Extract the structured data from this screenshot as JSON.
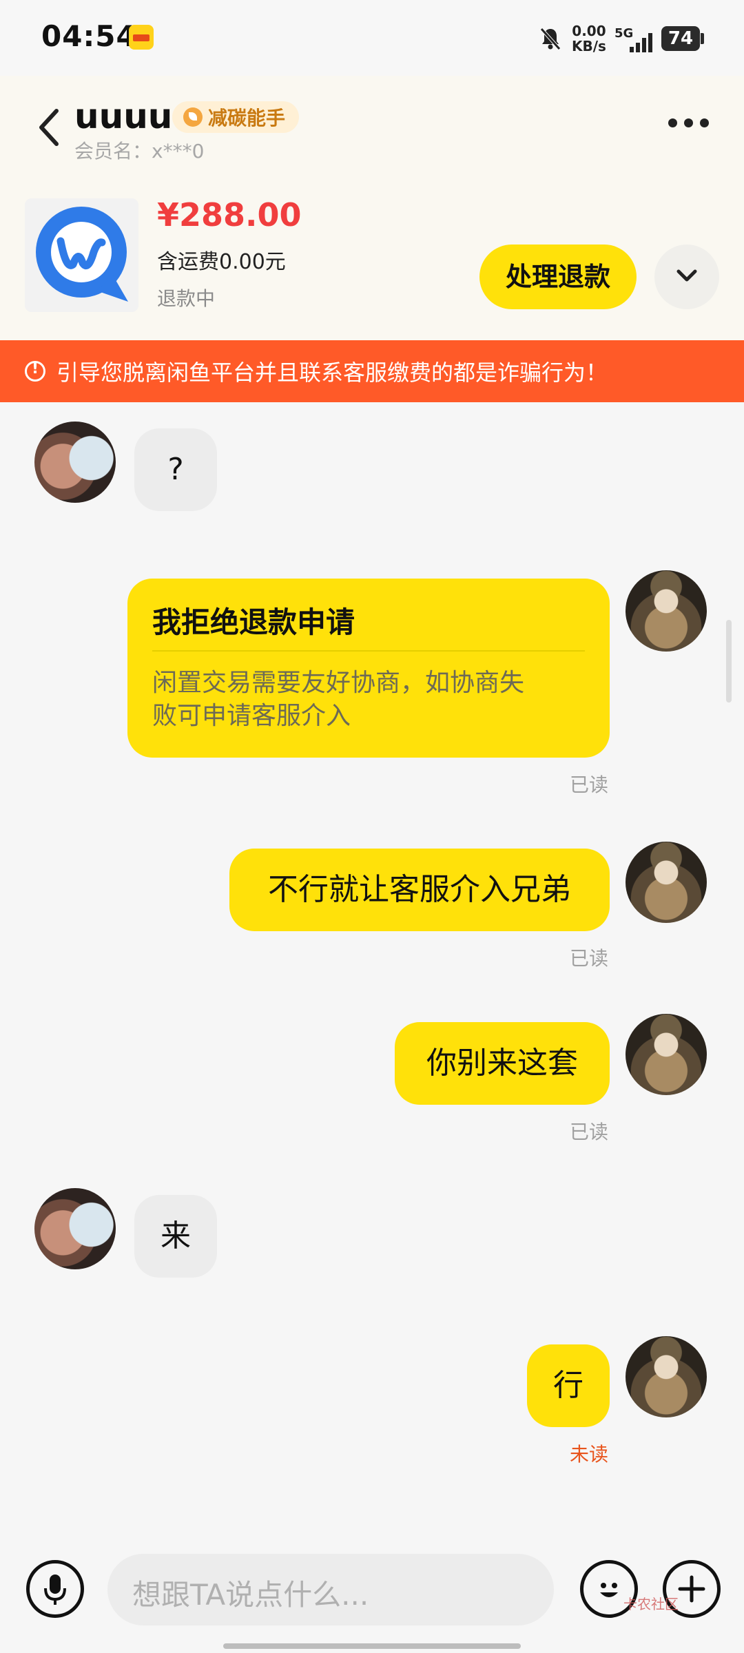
{
  "status_bar": {
    "time": "04:54",
    "net_speed_value": "0.00",
    "net_speed_unit": "KB/s",
    "network": "5G",
    "battery": "74"
  },
  "header": {
    "name": "uuuu",
    "tag": "减碳能手",
    "member_label": "会员名：x***0"
  },
  "product": {
    "price": "¥288.00",
    "shipping": "含运费0.00元",
    "state": "退款中",
    "action_label": "处理退款"
  },
  "warning": {
    "text": "引导您脱离闲鱼平台并且联系客服缴费的都是诈骗行为！"
  },
  "messages": [
    {
      "from": "other",
      "text": "?"
    },
    {
      "from": "me",
      "type": "card",
      "title": "我拒绝退款申请",
      "body_line1": "闲置交易需要友好协商，如协商失",
      "body_line2": "败可申请客服介入",
      "status": "已读"
    },
    {
      "from": "me",
      "text": "不行就让客服介入兄弟",
      "status": "已读"
    },
    {
      "from": "me",
      "text": "你别来这套",
      "status": "已读"
    },
    {
      "from": "other",
      "text": "来"
    },
    {
      "from": "me",
      "text": "行",
      "status": "未读"
    }
  ],
  "input": {
    "placeholder": "想跟TA说点什么..."
  },
  "watermark": "卡农社区",
  "colors": {
    "accent_yellow": "#ffe10a",
    "warning_orange": "#ff5a28",
    "price_red": "#f03e3e",
    "unread_orange": "#e8541c"
  }
}
